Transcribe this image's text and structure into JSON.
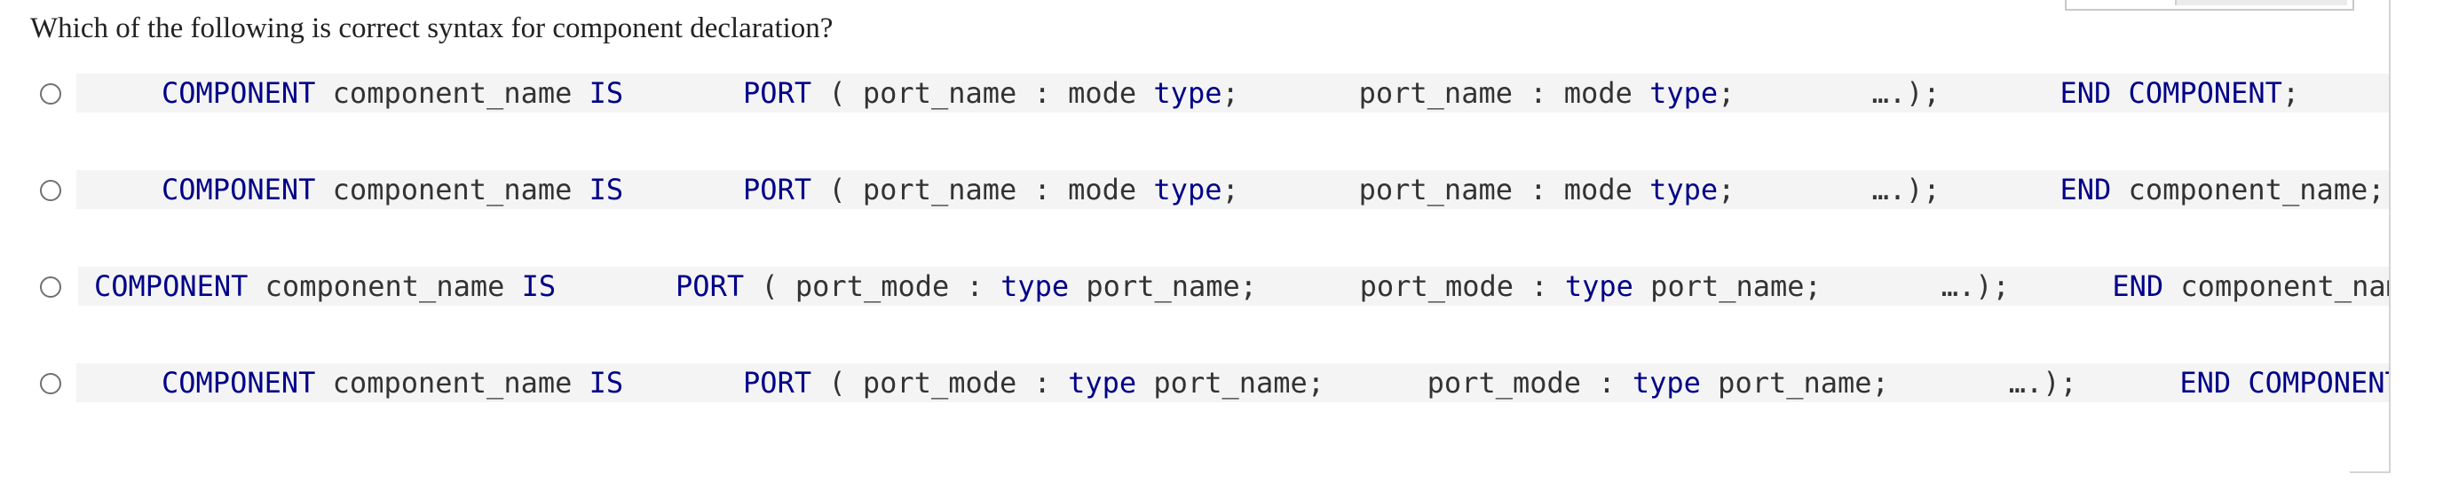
{
  "question": {
    "text": "Which of the following is correct syntax for component declaration?"
  },
  "options": [
    {
      "tokens": [
        {
          "t": "COMPONENT",
          "k": "kw"
        },
        {
          "t": " component_name ",
          "k": "pn"
        },
        {
          "t": "IS",
          "k": "kw"
        },
        {
          "t": "       ",
          "k": "pn"
        },
        {
          "t": "PORT",
          "k": "kw"
        },
        {
          "t": " ( port_name : mode ",
          "k": "pn"
        },
        {
          "t": "type",
          "k": "kw"
        },
        {
          "t": ";",
          "k": "pn"
        },
        {
          "t": "       port_name : mode ",
          "k": "pn"
        },
        {
          "t": "type",
          "k": "kw"
        },
        {
          "t": ";",
          "k": "pn"
        },
        {
          "t": "        ….);",
          "k": "pn"
        },
        {
          "t": "       ",
          "k": "pn"
        },
        {
          "t": "END COMPONENT",
          "k": "kw"
        },
        {
          "t": ";",
          "k": "pn"
        }
      ]
    },
    {
      "tokens": [
        {
          "t": "COMPONENT",
          "k": "kw"
        },
        {
          "t": " component_name ",
          "k": "pn"
        },
        {
          "t": "IS",
          "k": "kw"
        },
        {
          "t": "       ",
          "k": "pn"
        },
        {
          "t": "PORT",
          "k": "kw"
        },
        {
          "t": " ( port_name : mode ",
          "k": "pn"
        },
        {
          "t": "type",
          "k": "kw"
        },
        {
          "t": ";",
          "k": "pn"
        },
        {
          "t": "       port_name : mode ",
          "k": "pn"
        },
        {
          "t": "type",
          "k": "kw"
        },
        {
          "t": ";",
          "k": "pn"
        },
        {
          "t": "        ….);",
          "k": "pn"
        },
        {
          "t": "       ",
          "k": "pn"
        },
        {
          "t": "END",
          "k": "kw"
        },
        {
          "t": " component_name;",
          "k": "pn"
        }
      ]
    },
    {
      "tokens": [
        {
          "t": "COMPONENT",
          "k": "kw"
        },
        {
          "t": " component_name ",
          "k": "pn"
        },
        {
          "t": "IS",
          "k": "kw"
        },
        {
          "t": "       ",
          "k": "pn"
        },
        {
          "t": "PORT",
          "k": "kw"
        },
        {
          "t": " ( port_mode : ",
          "k": "pn"
        },
        {
          "t": "type",
          "k": "kw"
        },
        {
          "t": " port_name;",
          "k": "pn"
        },
        {
          "t": "      port_mode : ",
          "k": "pn"
        },
        {
          "t": "type",
          "k": "kw"
        },
        {
          "t": " port_name;",
          "k": "pn"
        },
        {
          "t": "       ….);",
          "k": "pn"
        },
        {
          "t": "      ",
          "k": "pn"
        },
        {
          "t": "END",
          "k": "kw"
        },
        {
          "t": " component_name",
          "k": "pn"
        }
      ]
    },
    {
      "tokens": [
        {
          "t": "COMPONENT",
          "k": "kw"
        },
        {
          "t": " component_name ",
          "k": "pn"
        },
        {
          "t": "IS",
          "k": "kw"
        },
        {
          "t": "       ",
          "k": "pn"
        },
        {
          "t": "PORT",
          "k": "kw"
        },
        {
          "t": " ( port_mode : ",
          "k": "pn"
        },
        {
          "t": "type",
          "k": "kw"
        },
        {
          "t": " port_name;",
          "k": "pn"
        },
        {
          "t": "      port_mode : ",
          "k": "pn"
        },
        {
          "t": "type",
          "k": "kw"
        },
        {
          "t": " port_name;",
          "k": "pn"
        },
        {
          "t": "       ….);",
          "k": "pn"
        },
        {
          "t": "      ",
          "k": "pn"
        },
        {
          "t": "END COMPONENT",
          "k": "kw"
        },
        {
          "t": ";",
          "k": "pn"
        }
      ]
    }
  ],
  "colors": {
    "keyword": "#000088",
    "plain": "#333333",
    "code_background": "#f4f4f4"
  }
}
